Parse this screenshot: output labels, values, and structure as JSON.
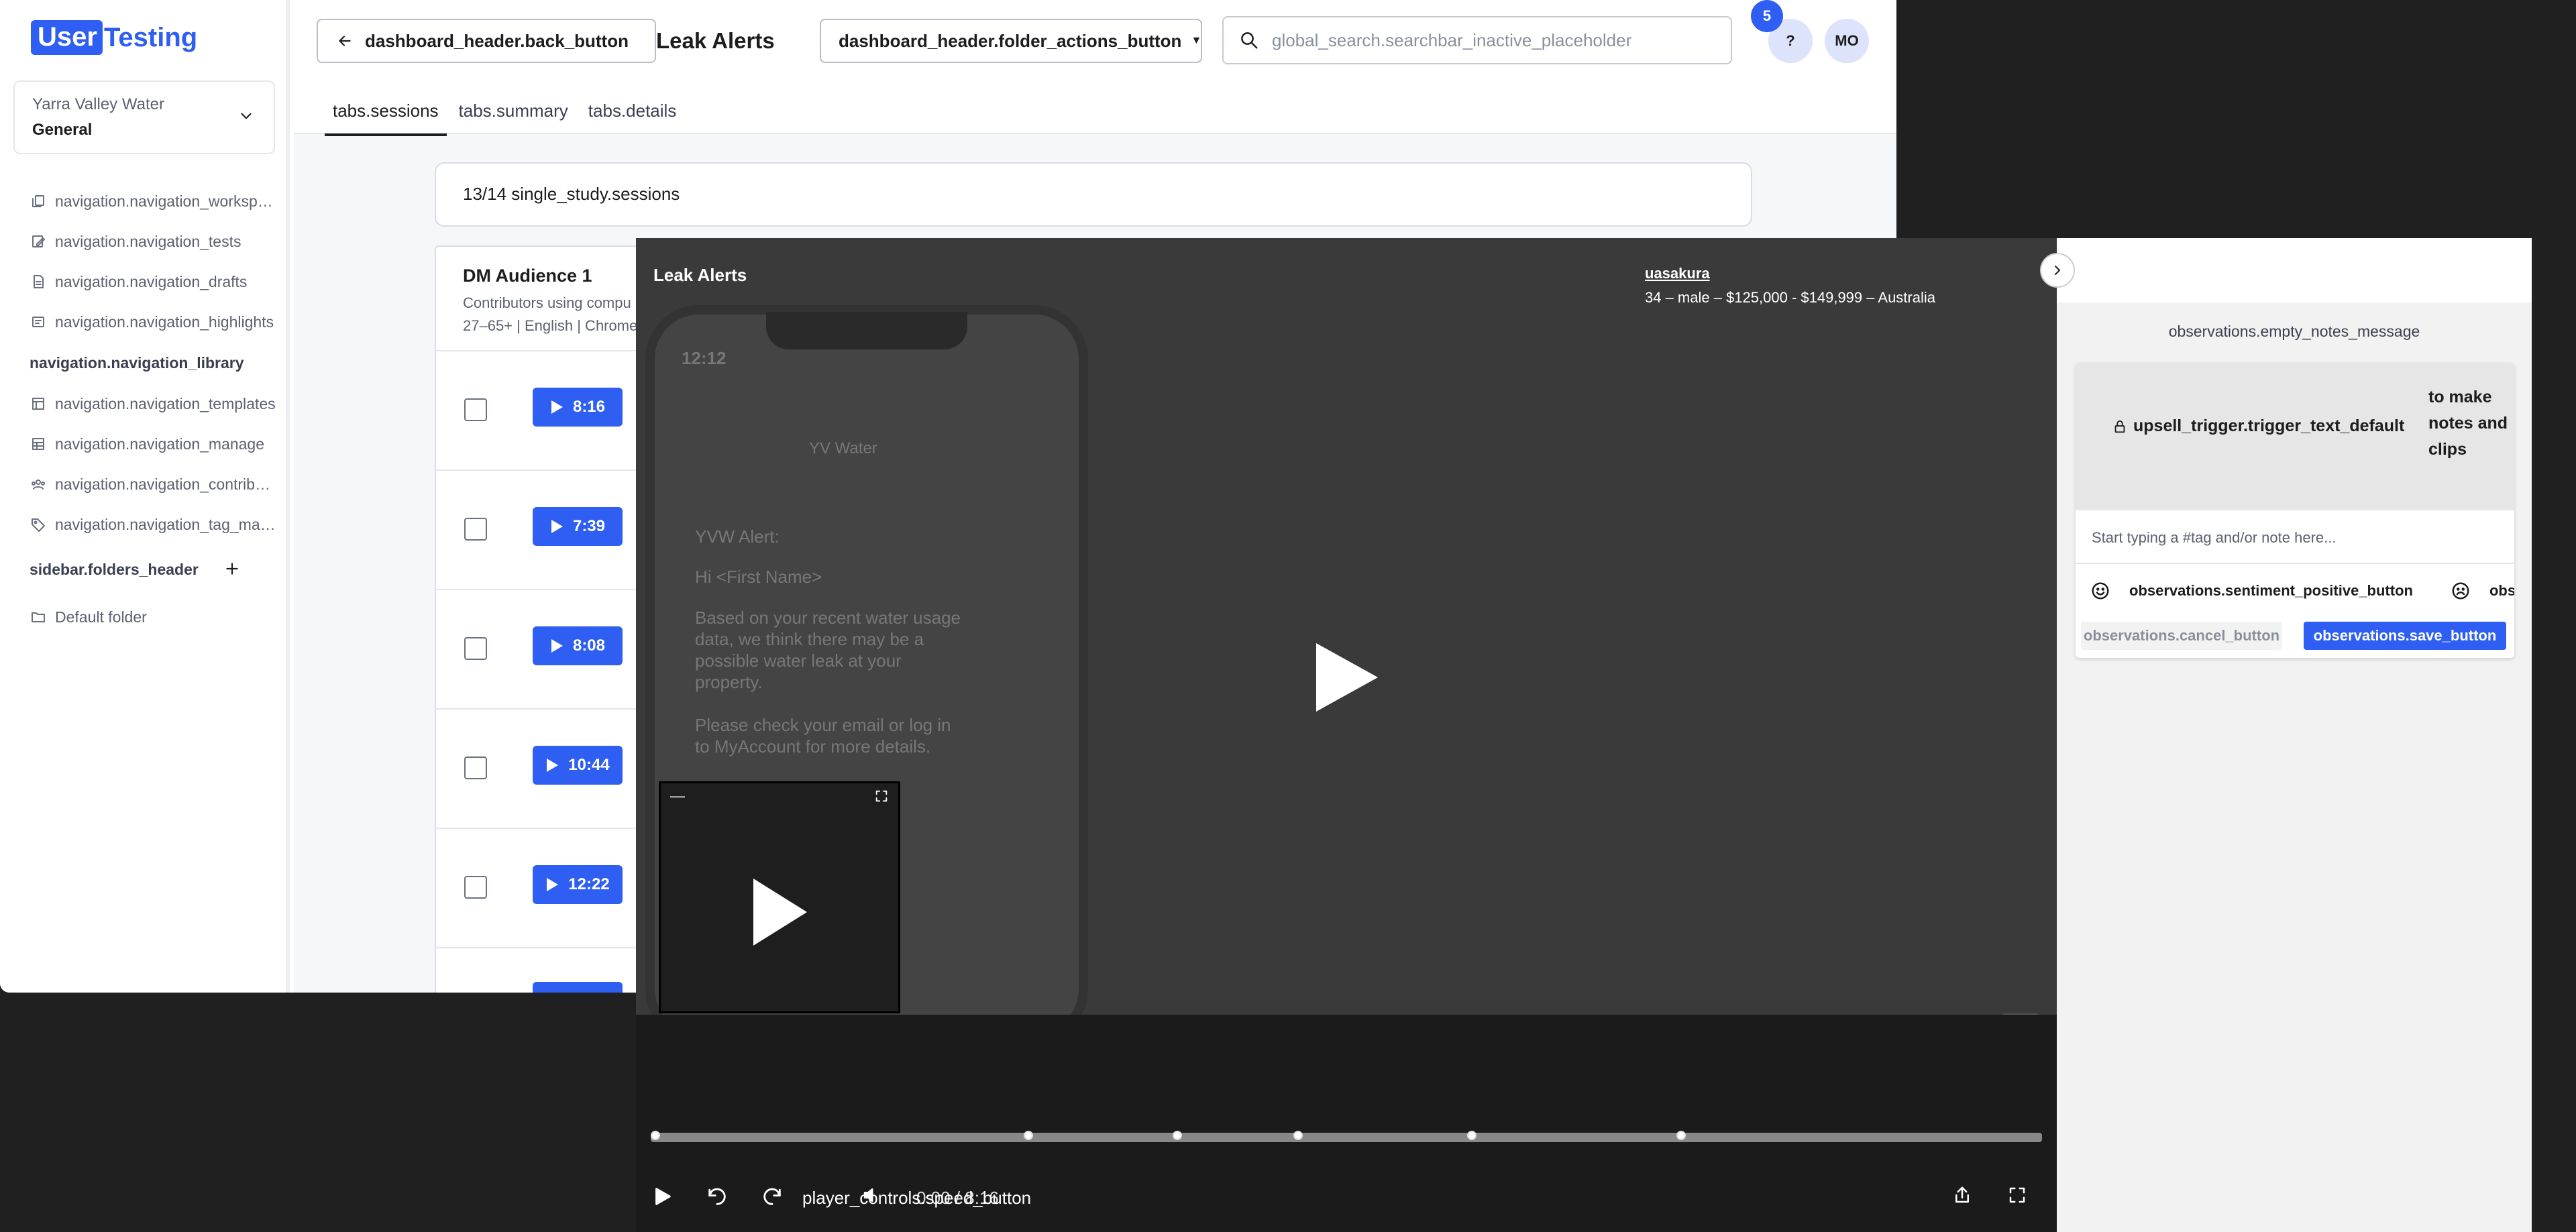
{
  "brand": {
    "logo_part1": "User",
    "logo_part2": "Testing",
    "accent": "#2f5ef3"
  },
  "sidebar": {
    "workspace_org": "Yarra Valley Water",
    "workspace_team": "General",
    "items": [
      {
        "label": "navigation.navigation_workspace",
        "icon": "copy-icon"
      },
      {
        "label": "navigation.navigation_tests",
        "icon": "edit-icon"
      },
      {
        "label": "navigation.navigation_drafts",
        "icon": "file-icon"
      },
      {
        "label": "navigation.navigation_highlights",
        "icon": "highlight-icon"
      }
    ],
    "library_header": "navigation.navigation_library",
    "library_items": [
      {
        "label": "navigation.navigation_templates",
        "icon": "template-icon"
      },
      {
        "label": "navigation.navigation_manage",
        "icon": "table-icon"
      },
      {
        "label": "navigation.navigation_contributors",
        "icon": "users-icon"
      },
      {
        "label": "navigation.navigation_tag_manager",
        "icon": "tag-icon"
      }
    ],
    "folders_header": "sidebar.folders_header",
    "folders": [
      {
        "label": "Default folder",
        "icon": "folder-icon"
      }
    ]
  },
  "header": {
    "back_label": "dashboard_header.back_button",
    "title": "Leak Alerts",
    "folder_actions_label": "dashboard_header.folder_actions_button",
    "search_placeholder": "global_search.searchbar_inactive_placeholder",
    "help_label": "?",
    "notif_count": "5",
    "avatar_initials": "MO"
  },
  "tabs": [
    "tabs.sessions",
    "tabs.summary",
    "tabs.details"
  ],
  "sessions": {
    "count_label": "13/14 single_study.sessions",
    "audience_title": "DM Audience 1",
    "audience_desc": "Contributors using compu",
    "audience_meta": "27–65+ | English | Chrome",
    "rows": [
      "8:16",
      "7:39",
      "8:08",
      "10:44",
      "12:22",
      ""
    ]
  },
  "player": {
    "title": "Leak Alerts",
    "username": "uasakura",
    "demographics": "34 – male – $125,000 - $149,999 – Australia",
    "speed_label": "player_controls.speed_button",
    "time_label": "0:00 / 8:16",
    "phone_time": "12:12",
    "phone_app": "YV Water",
    "phone_lines": [
      "YVW Alert:",
      "Hi <First Name>",
      "Based on your recent water usage data, we think there may be a possible water leak at your property.",
      "Please check your email or log in to MyAccount for more details."
    ],
    "progress": 0.0,
    "markers": [
      0.0,
      0.268,
      0.375,
      0.462,
      0.587,
      0.737
    ]
  },
  "notes": {
    "empty_message": "observations.empty_notes_message",
    "upsell_text": "upsell_trigger.trigger_text_default",
    "upsell_side": "to make notes and clips",
    "note_placeholder": "Start typing a #tag and/or note here...",
    "sentiment_positive": "observations.sentiment_positive_button",
    "sentiment_negative": "obse",
    "cancel_label": "observations.cancel_button",
    "save_label": "observations.save_button"
  }
}
